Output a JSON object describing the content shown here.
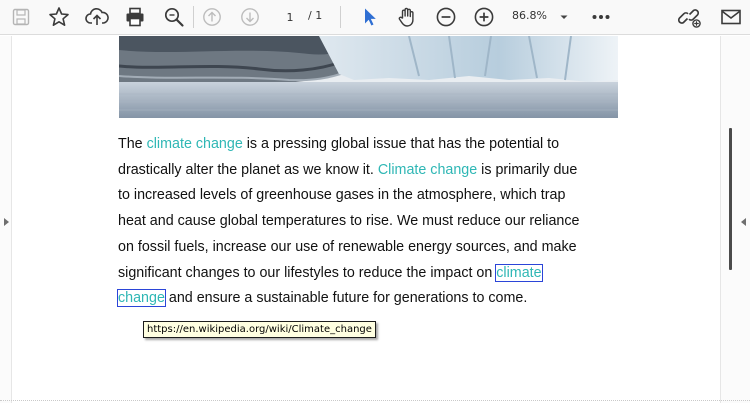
{
  "toolbar": {
    "page": {
      "current": "1",
      "total_text": "/ 1"
    },
    "zoom": {
      "value": "86.8%"
    },
    "icons": [
      "save-icon",
      "bookmark-star-icon",
      "upload-icon",
      "print-icon",
      "search-icon",
      "page-up-icon",
      "page-down-icon",
      "select-pointer-icon",
      "hand-tool-icon",
      "zoom-out-icon",
      "zoom-in-icon",
      "more-icon",
      "share-link-icon",
      "email-icon"
    ],
    "accent_color": "#2f6fd3"
  },
  "document": {
    "lines": [
      [
        {
          "t": "The "
        },
        {
          "t": "climate change",
          "link": true
        },
        {
          "t": " is a pressing global issue that has the potential to"
        }
      ],
      [
        {
          "t": "drastically alter the planet as we know it. "
        },
        {
          "t": "Climate change",
          "link": true
        },
        {
          "t": " is primarily due"
        }
      ],
      [
        {
          "t": "to increased levels of greenhouse gases in the atmosphere, which trap"
        }
      ],
      [
        {
          "t": "heat and cause global temperatures to rise. We must reduce our reliance"
        }
      ],
      [
        {
          "t": "on fossil fuels, increase our use of renewable energy sources, and make"
        }
      ],
      [
        {
          "t": "significant changes to our lifestyles to reduce the impact on "
        },
        {
          "t": "climate",
          "link": true,
          "box": true
        }
      ],
      [
        {
          "t": "change",
          "link": true,
          "box": true
        },
        {
          "t": " and ensure a sustainable future for generations to come."
        }
      ]
    ],
    "link_color": "#2fb7b5",
    "hover_box_color": "#2b45d8"
  },
  "tooltip": {
    "text": "https://en.wikipedia.org/wiki/Climate_change"
  }
}
